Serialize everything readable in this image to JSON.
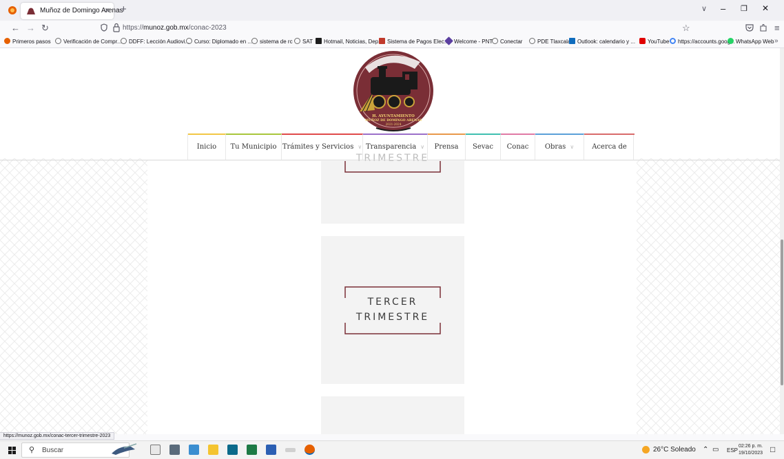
{
  "browser": {
    "tab_title": "Muñoz de Domingo Arenas",
    "tab_close": "×",
    "new_tab": "+",
    "url_prefix": "https://",
    "url_domain": "munoz.gob.mx",
    "url_path": "/conac-2023",
    "bookmarks": [
      {
        "label": "Primeros pasos",
        "color": "#e66000"
      },
      {
        "label": "Verificación de Compr...",
        "color": "#6b6b6b"
      },
      {
        "label": "DDFF: Lección Audiovi...",
        "color": "#6b6b6b"
      },
      {
        "label": "Curso: Diplomado en ...",
        "color": "#6b6b6b"
      },
      {
        "label": "sistema de rc",
        "color": "#6b6b6b"
      },
      {
        "label": "SAT",
        "color": "#6b6b6b"
      },
      {
        "label": "Hotmail, Noticias, Dep...",
        "color": "#1e1e1e"
      },
      {
        "label": "Sistema de Pagos Elec...",
        "color": "#c0392b"
      },
      {
        "label": "Welcome - PNT",
        "color": "#5b3fa0"
      },
      {
        "label": "Conectar",
        "color": "#6b6b6b"
      },
      {
        "label": "PDE Tlaxcala",
        "color": "#6b6b6b"
      },
      {
        "label": "Outlook: calendario y ...",
        "color": "#0f6cbd"
      },
      {
        "label": "YouTube",
        "color": "#e00000"
      },
      {
        "label": "https://accounts.goog...",
        "color": "#4285f4"
      },
      {
        "label": "WhatsApp Web",
        "color": "#25d366"
      }
    ],
    "bookmarks_more": "»"
  },
  "site": {
    "logo_text_line1": "H. AYUNTAMIENTO",
    "logo_text_line2": "MUÑOZ DE DOMINGO ARENAS",
    "logo_text_line3": "2021-2024",
    "menu": [
      {
        "label": "Inicio",
        "color": "#f2c744",
        "dropdown": false
      },
      {
        "label": "Tu Municipio",
        "color": "#a8c63b",
        "dropdown": false
      },
      {
        "label": "Trámites y Servicios",
        "color": "#e04a4a",
        "dropdown": true
      },
      {
        "label": "Transparencia",
        "color": "#9b6fc9",
        "dropdown": true
      },
      {
        "label": "Prensa",
        "color": "#e8984a",
        "dropdown": false
      },
      {
        "label": "Sevac",
        "color": "#3fbfb0",
        "dropdown": false
      },
      {
        "label": "Conac",
        "color": "#e07aa5",
        "dropdown": false
      },
      {
        "label": "Obras",
        "color": "#5aa0d8",
        "dropdown": true
      },
      {
        "label": "Acerca de",
        "color": "#d86a6a",
        "dropdown": false
      }
    ],
    "cards": [
      {
        "line1": "",
        "line2": "TRIMESTRE"
      },
      {
        "line1": "TERCER",
        "line2": "TRIMESTRE"
      },
      {
        "line1": "",
        "line2": ""
      }
    ],
    "accent_color": "#7a2e36"
  },
  "status_url": "https://munoz.gob.mx/conac-tercer-trimestre-2023",
  "taskbar": {
    "search_placeholder": "Buscar",
    "weather": "26°C  Soleado",
    "language": "ESP",
    "time": "02:26 p. m.",
    "date": "19/10/2023"
  }
}
